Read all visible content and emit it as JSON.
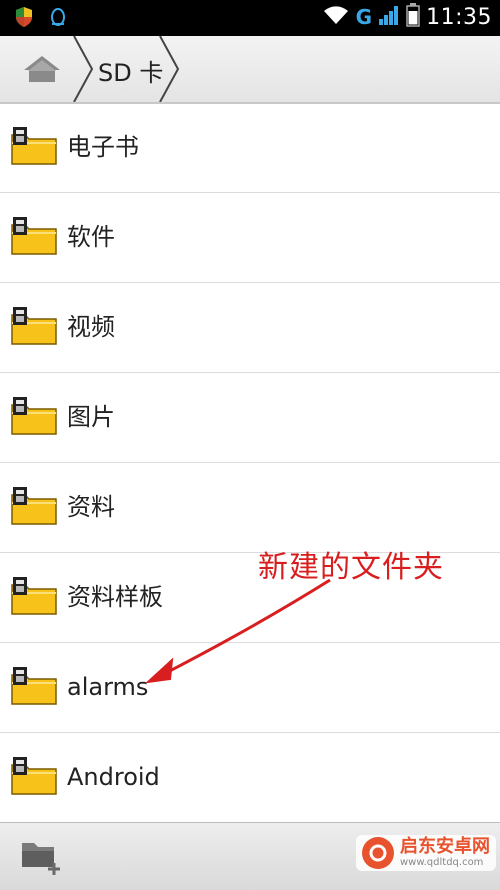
{
  "status_bar": {
    "network_label": "G",
    "time": "11:35"
  },
  "breadcrumb": {
    "current": "SD 卡"
  },
  "folders": [
    {
      "name": "电子书"
    },
    {
      "name": "软件"
    },
    {
      "name": "视频"
    },
    {
      "name": "图片"
    },
    {
      "name": "资料"
    },
    {
      "name": "资料样板"
    },
    {
      "name": "alarms"
    },
    {
      "name": "Android"
    }
  ],
  "annotation": {
    "text": "新建的文件夹",
    "color": "#d81e1e"
  },
  "watermark": {
    "title": "启东安卓网",
    "url": "www.qdltdq.com"
  },
  "colors": {
    "folder": "#f7c21a",
    "accent_g": "#3aa8e8"
  }
}
